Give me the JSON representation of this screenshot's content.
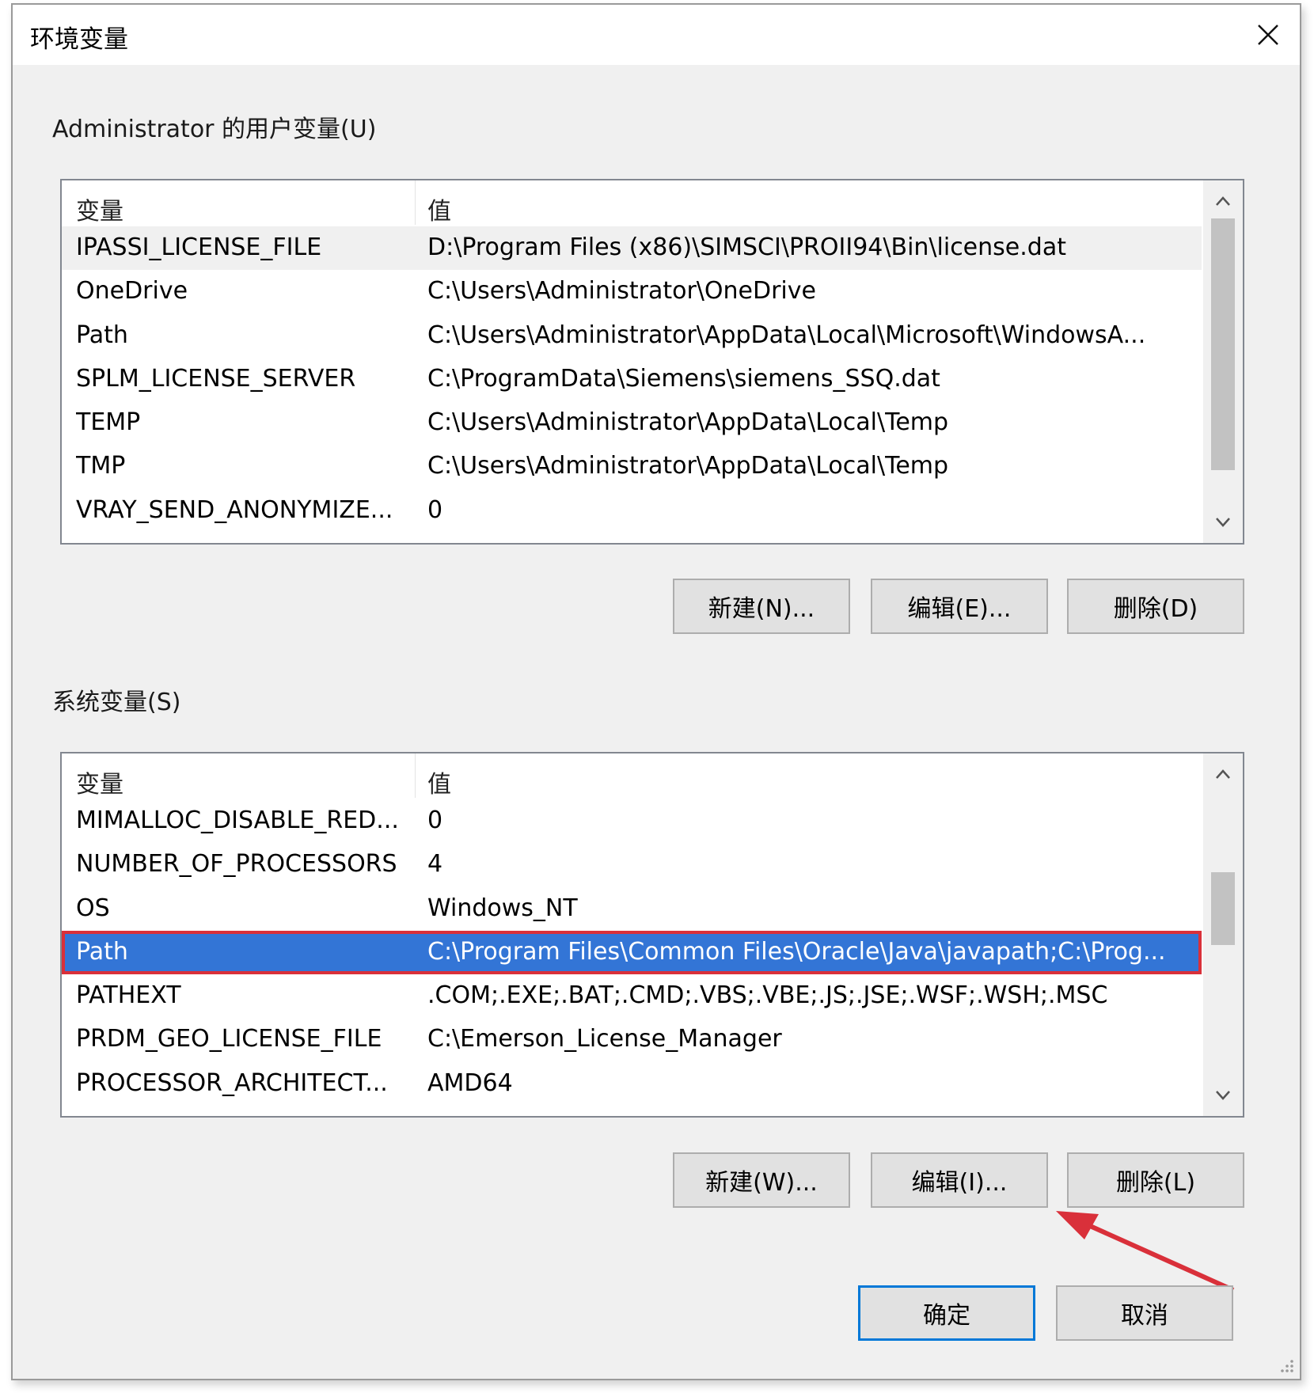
{
  "window": {
    "title": "环境变量",
    "close_icon": "close-icon"
  },
  "user_vars": {
    "label": "Administrator 的用户变量(U)",
    "col_variable": "变量",
    "col_value": "值",
    "rows": [
      {
        "variable": "IPASSI_LICENSE_FILE",
        "value": "D:\\Program Files (x86)\\SIMSCI\\PROII94\\Bin\\license.dat"
      },
      {
        "variable": "OneDrive",
        "value": "C:\\Users\\Administrator\\OneDrive"
      },
      {
        "variable": "Path",
        "value": "C:\\Users\\Administrator\\AppData\\Local\\Microsoft\\WindowsA..."
      },
      {
        "variable": "SPLM_LICENSE_SERVER",
        "value": "C:\\ProgramData\\Siemens\\siemens_SSQ.dat"
      },
      {
        "variable": "TEMP",
        "value": "C:\\Users\\Administrator\\AppData\\Local\\Temp"
      },
      {
        "variable": "TMP",
        "value": "C:\\Users\\Administrator\\AppData\\Local\\Temp"
      },
      {
        "variable": "VRAY_SEND_ANONYMIZE...",
        "value": "0"
      }
    ],
    "buttons": {
      "new": "新建(N)...",
      "edit": "编辑(E)...",
      "delete": "删除(D)"
    }
  },
  "system_vars": {
    "label": "系统变量(S)",
    "col_variable": "变量",
    "col_value": "值",
    "rows": [
      {
        "variable": "MIMALLOC_DISABLE_RED...",
        "value": "0"
      },
      {
        "variable": "NUMBER_OF_PROCESSORS",
        "value": "4"
      },
      {
        "variable": "OS",
        "value": "Windows_NT"
      },
      {
        "variable": "Path",
        "value": "C:\\Program Files\\Common Files\\Oracle\\Java\\javapath;C:\\Prog..."
      },
      {
        "variable": "PATHEXT",
        "value": ".COM;.EXE;.BAT;.CMD;.VBS;.VBE;.JS;.JSE;.WSF;.WSH;.MSC"
      },
      {
        "variable": "PRDM_GEO_LICENSE_FILE",
        "value": "C:\\Emerson_License_Manager"
      },
      {
        "variable": "PROCESSOR_ARCHITECT...",
        "value": "AMD64"
      }
    ],
    "selected_row": "Path",
    "buttons": {
      "new": "新建(W)...",
      "edit": "编辑(I)...",
      "delete": "删除(L)"
    }
  },
  "footer": {
    "ok": "确定",
    "cancel": "取消"
  },
  "colors": {
    "selection": "#3375d6",
    "annotation": "#d9303a",
    "default_button_border": "#0078d7"
  }
}
